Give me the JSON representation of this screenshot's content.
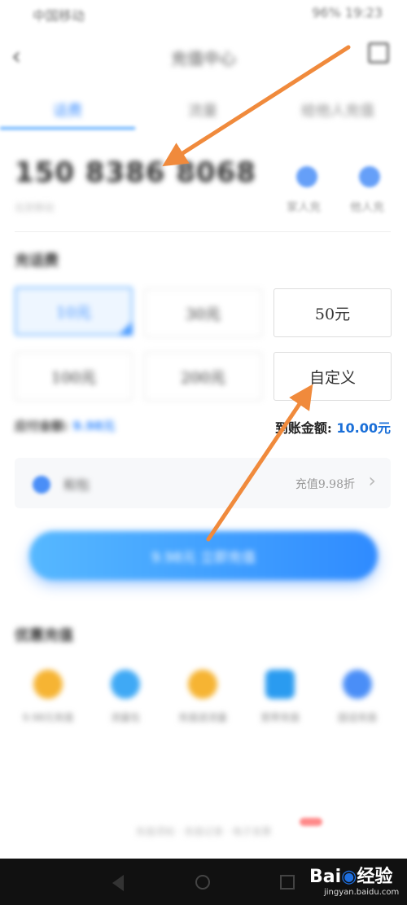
{
  "status_bar": {
    "left": "中国移动",
    "right": "96% 19:23"
  },
  "nav": {
    "back_icon": "chevron-left-icon",
    "title": "充值中心",
    "share_icon": "share-icon"
  },
  "tabs": [
    {
      "label": "话费"
    },
    {
      "label": "流量"
    },
    {
      "label": "给他人充值"
    }
  ],
  "phone": {
    "number": "150 8386 8068",
    "edit_icon": "edit-icon",
    "sub": "北京移动"
  },
  "quick_actions": [
    {
      "label": "家人充"
    },
    {
      "label": "他人充"
    }
  ],
  "recharge": {
    "title": "充话费",
    "amounts": [
      "10元",
      "30元",
      "50元",
      "100元",
      "200元",
      "自定义"
    ]
  },
  "summary": {
    "pay_label": "应付金额:",
    "pay_value": "9.98元",
    "recv_label": "到账金额:",
    "recv_value": "10.00元"
  },
  "payment": {
    "method": "和包",
    "discount": "充值9.98折",
    "chevron": "chevron-right-icon"
  },
  "cta": {
    "label": "9.98元 立即充值"
  },
  "services": {
    "title": "优惠充值",
    "items": [
      {
        "label": "9.98元充值",
        "color": "#f6b433"
      },
      {
        "label": "流量包",
        "color": "#3fa9f5"
      },
      {
        "label": "充值送流量",
        "color": "#f6b433"
      },
      {
        "label": "宽带充值",
        "color": "#2a9bf0"
      },
      {
        "label": "固话充值",
        "color": "#4a8ef7"
      }
    ]
  },
  "footer": {
    "links": "充值须知 · 充值记录 · 电子发票"
  },
  "watermark": {
    "brand_left": "Bai",
    "brand_paw": "◉",
    "brand_right": "经验",
    "sub": "jingyan.baidu.com"
  }
}
